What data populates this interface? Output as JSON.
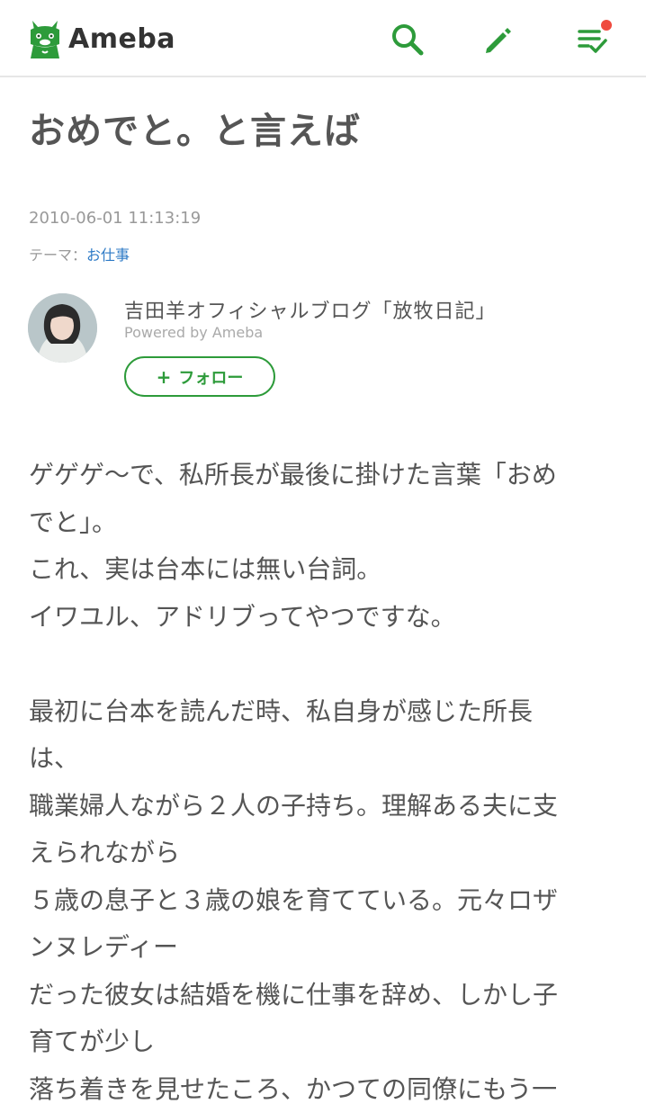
{
  "header": {
    "logo_text": "Ameba",
    "icons": [
      "ameba-logo-icon",
      "search-icon",
      "pencil-icon",
      "checklist-icon"
    ],
    "accent_color": "#2d9b3a",
    "notification_dot_color": "#ef4b3f"
  },
  "article": {
    "title": "おめでと。と言えば",
    "date": "2010-06-01 11:13:19",
    "theme_label": "テーマ：",
    "theme_link": "お仕事"
  },
  "author": {
    "blog_name": "吉田羊オフィシャルブログ「放牧日記」",
    "powered_by": "Powered by Ameba",
    "follow_label": "フォロー",
    "follow_plus": "+"
  },
  "body": {
    "lines": [
      "ゲゲゲ〜で、私所長が最後に掛けた言葉「おめ",
      "でと」。",
      "これ、実は台本には無い台詞。",
      "イワユル、アドリブってやつですな。",
      "",
      "最初に台本を読んだ時、私自身が感じた所長",
      "は、",
      "職業婦人ながら２人の子持ち。理解ある夫に支",
      "えられながら",
      "５歳の息子と３歳の娘を育てている。元々ロザ",
      "ンヌレディー",
      "だった彼女は結婚を機に仕事を辞め、しかし子",
      "育てが少し",
      "落ち着きを見せたころ、かつての同僚にもう一"
    ]
  }
}
